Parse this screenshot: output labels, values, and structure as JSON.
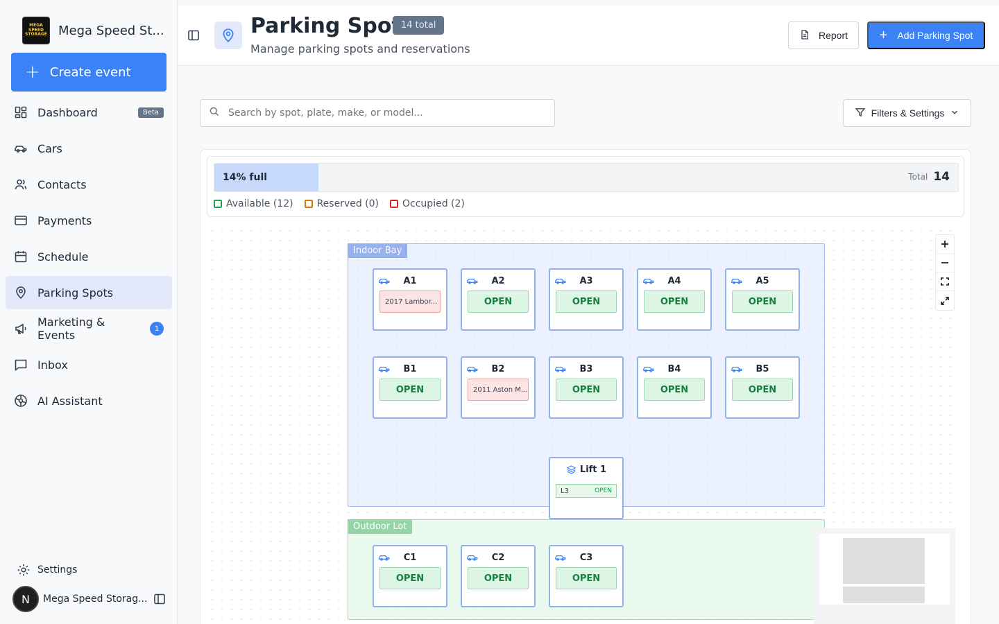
{
  "sidebar": {
    "brand_name": "Mega Speed St...",
    "brand_logo_text": "MEGA SPEED STORAGE",
    "create_label": "Create event",
    "items": [
      {
        "label": "Dashboard",
        "icon": "dashboard-icon",
        "badge": "Beta"
      },
      {
        "label": "Cars",
        "icon": "car-icon"
      },
      {
        "label": "Contacts",
        "icon": "contacts-icon"
      },
      {
        "label": "Payments",
        "icon": "credit-card-icon"
      },
      {
        "label": "Schedule",
        "icon": "calendar-icon"
      },
      {
        "label": "Parking Spots",
        "icon": "map-pin-icon",
        "active": true
      },
      {
        "label": "Marketing & Events",
        "icon": "megaphone-icon",
        "badge": "1"
      },
      {
        "label": "Inbox",
        "icon": "message-square-icon"
      },
      {
        "label": "AI Assistant",
        "icon": "sparkle-icon"
      }
    ],
    "settings_label": "Settings",
    "user_initial": "N",
    "user_name": "Mega Speed Storag..."
  },
  "header": {
    "title": "Parking Spots",
    "total_pill": "14 total",
    "subtitle": "Manage parking spots and reservations",
    "report_label": "Report",
    "add_label": "Add Parking Spot"
  },
  "search": {
    "placeholder": "Search by spot, plate, make, or model..."
  },
  "filters_label": "Filters & Settings",
  "occupancy": {
    "percent": 14,
    "label": "14% full",
    "total_label": "Total",
    "total_value": "14"
  },
  "legend": [
    {
      "label": "Available (12)",
      "color": "#16a34a"
    },
    {
      "label": "Reserved (0)",
      "color": "#d97706"
    },
    {
      "label": "Occupied (2)",
      "color": "#dc2626"
    }
  ],
  "zones": {
    "indoor": "Indoor Bay",
    "outdoor": "Outdoor Lot"
  },
  "spots": {
    "A1": {
      "name": "A1",
      "status": "2017 Lambor...",
      "occupied": true
    },
    "A2": {
      "name": "A2",
      "status": "OPEN"
    },
    "A3": {
      "name": "A3",
      "status": "OPEN"
    },
    "A4": {
      "name": "A4",
      "status": "OPEN"
    },
    "A5": {
      "name": "A5",
      "status": "OPEN"
    },
    "B1": {
      "name": "B1",
      "status": "OPEN"
    },
    "B2": {
      "name": "B2",
      "status": "2011 Aston M...",
      "occupied": true
    },
    "B3": {
      "name": "B3",
      "status": "OPEN"
    },
    "B4": {
      "name": "B4",
      "status": "OPEN"
    },
    "B5": {
      "name": "B5",
      "status": "OPEN"
    },
    "C1": {
      "name": "C1",
      "status": "OPEN"
    },
    "C2": {
      "name": "C2",
      "status": "OPEN"
    },
    "C3": {
      "name": "C3",
      "status": "OPEN"
    }
  },
  "lift": {
    "name": "Lift 1",
    "level": "L3",
    "level_status": "OPEN"
  },
  "colors": {
    "accent": "#3b82f6",
    "open_text": "#15803d",
    "occupied_bg": "#fde4e4"
  }
}
